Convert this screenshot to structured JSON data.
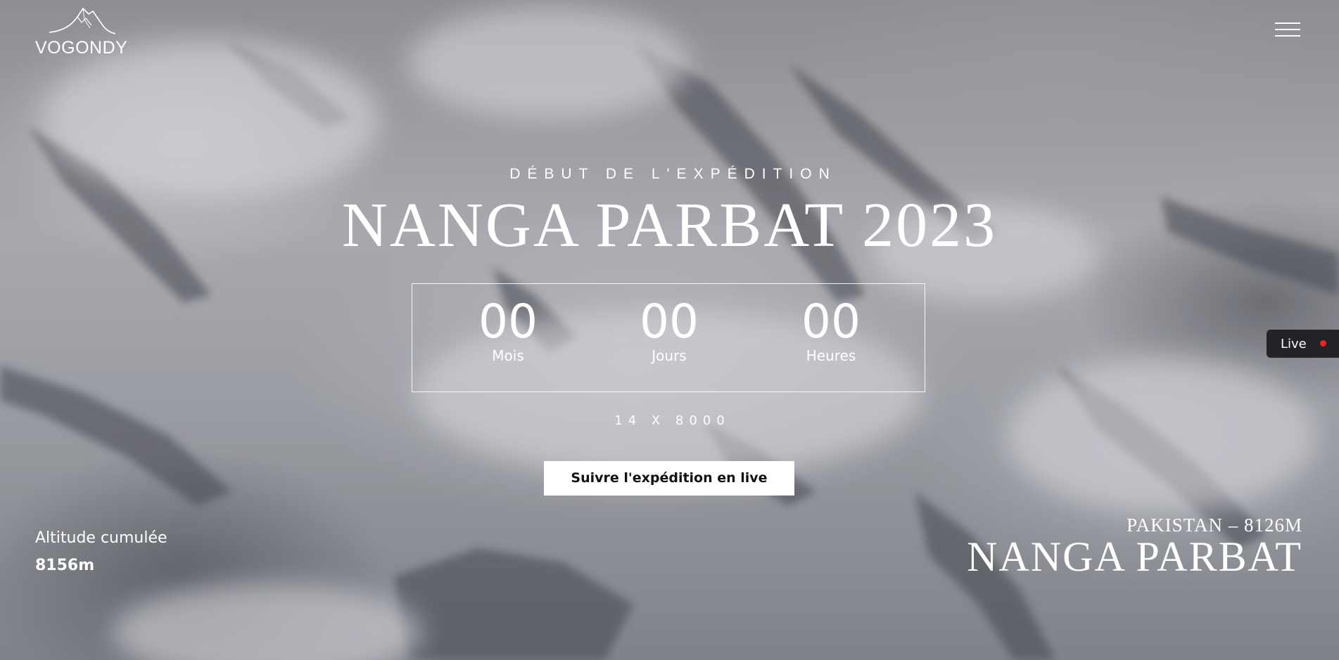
{
  "brand": {
    "name": "VOGONDY"
  },
  "header": {
    "menu_icon": "hamburger-menu-icon"
  },
  "hero": {
    "subtitle": "DÉBUT DE L'EXPÉDITION",
    "title": "NANGA PARBAT 2023",
    "countdown": [
      {
        "value": "00",
        "label": "Mois"
      },
      {
        "value": "00",
        "label": "Jours"
      },
      {
        "value": "00",
        "label": "Heures"
      }
    ],
    "tagline": "14 X 8000",
    "cta_label": "Suivre l'expédition en live"
  },
  "live_tab": {
    "label": "Live",
    "dot_color": "#e5262b"
  },
  "altitude": {
    "label": "Altitude cumulée",
    "value": "8156m"
  },
  "peak": {
    "location": "PAKISTAN – 8126M",
    "name": "NANGA PARBAT"
  },
  "colors": {
    "text": "#ffffff",
    "button_bg": "#ffffff",
    "button_text": "#111111",
    "live_bg": "#222326"
  }
}
